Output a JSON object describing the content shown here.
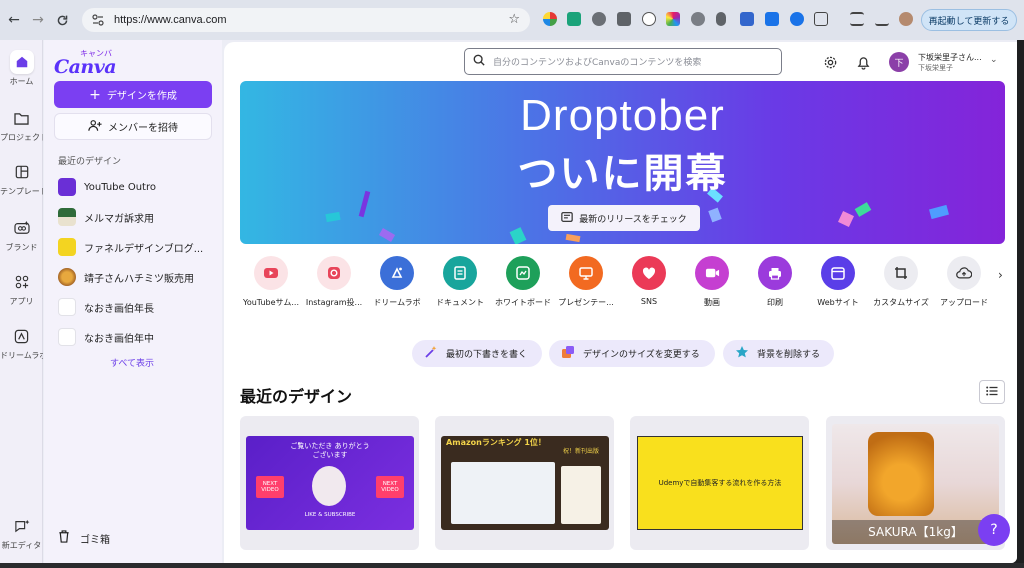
{
  "browser": {
    "url": "https://www.canva.com",
    "relaunch_label": "再起動して更新する"
  },
  "rail": [
    {
      "id": "home",
      "label": "ホーム",
      "icon": "home-icon"
    },
    {
      "id": "projects",
      "label": "プロジェクト",
      "icon": "folder-icon"
    },
    {
      "id": "templates",
      "label": "テンプレート",
      "icon": "template-icon"
    },
    {
      "id": "brand",
      "label": "ブランド",
      "icon": "brand-icon"
    },
    {
      "id": "apps",
      "label": "アプリ",
      "icon": "apps-icon"
    },
    {
      "id": "dream",
      "label": "ドリームラボ",
      "icon": "dreamlab-icon"
    },
    {
      "id": "new_editor",
      "label": "新エディタ",
      "icon": "new-editor-icon"
    }
  ],
  "logo": {
    "kana": "キャンバ",
    "word": "Canva"
  },
  "panel": {
    "create_label": "デザインを作成",
    "invite_label": "メンバーを招待",
    "recent_label": "最近のデザイン",
    "show_all": "すべて表示",
    "trash_label": "ゴミ箱",
    "recent": [
      {
        "name": "YouTube Outro",
        "color": "#6a2fd6"
      },
      {
        "name": "メルマガ訴求用",
        "color": "#2f6b3a"
      },
      {
        "name": "ファネルデザインブログ...",
        "color": "#f3d421"
      },
      {
        "name": "靖子さんハチミツ販売用",
        "color": "#c98a3a"
      },
      {
        "name": "なおき画伯年長",
        "color": "#ffffff"
      },
      {
        "name": "なおき画伯年中",
        "color": "#ffffff"
      }
    ]
  },
  "header": {
    "search_placeholder": "自分のコンテンツおよびCanvaのコンテンツを検索",
    "avatar_initial": "下",
    "user_name": "下坂栄里子さん...",
    "user_sub": "下坂栄里子"
  },
  "banner": {
    "title_line1": "Droptober",
    "title_line2": "ついに開幕",
    "button_label": "最新のリリースをチェック"
  },
  "categories": [
    {
      "label": "YouTubeサム...",
      "color": "#fbe3e6",
      "glyph": "#e8455a"
    },
    {
      "label": "Instagram投...",
      "color": "#fbe3e6",
      "glyph": "#e8455a"
    },
    {
      "label": "ドリームラボ",
      "color": "#3b6fd8",
      "glyph": "#ffffff"
    },
    {
      "label": "ドキュメント",
      "color": "#18a59c",
      "glyph": "#ffffff"
    },
    {
      "label": "ホワイトボード",
      "color": "#1ea05a",
      "glyph": "#ffffff"
    },
    {
      "label": "プレゼンテー...",
      "color": "#f26a21",
      "glyph": "#ffffff"
    },
    {
      "label": "SNS",
      "color": "#eb3a57",
      "glyph": "#ffffff"
    },
    {
      "label": "動画",
      "color": "#c53fd1",
      "glyph": "#ffffff"
    },
    {
      "label": "印刷",
      "color": "#9b3bdc",
      "glyph": "#ffffff"
    },
    {
      "label": "Webサイト",
      "color": "#5a3ee8",
      "glyph": "#ffffff"
    },
    {
      "label": "カスタムサイズ",
      "color": "#ececf1",
      "glyph": "#333333"
    },
    {
      "label": "アップロード",
      "color": "#ececf1",
      "glyph": "#333333"
    }
  ],
  "pills": [
    {
      "label": "最初の下書きを書く"
    },
    {
      "label": "デザインのサイズを変更する"
    },
    {
      "label": "背景を削除する"
    }
  ],
  "recent_section": {
    "title": "最近のデザイン",
    "cards": [
      {
        "top_text": "ご覧いただき ありがとうございます",
        "badge": "NEXT VIDEO",
        "bottom_text": "LIKE & SUBSCRIBE"
      },
      {
        "top_text": "Amazonランキング 1位！",
        "badge": "祝！新刊出版"
      },
      {
        "top_text": "Udemyで自動集客する流れを作る方法"
      },
      {
        "top_text": "SAKURA【1kg】"
      }
    ]
  },
  "help_label": "?"
}
